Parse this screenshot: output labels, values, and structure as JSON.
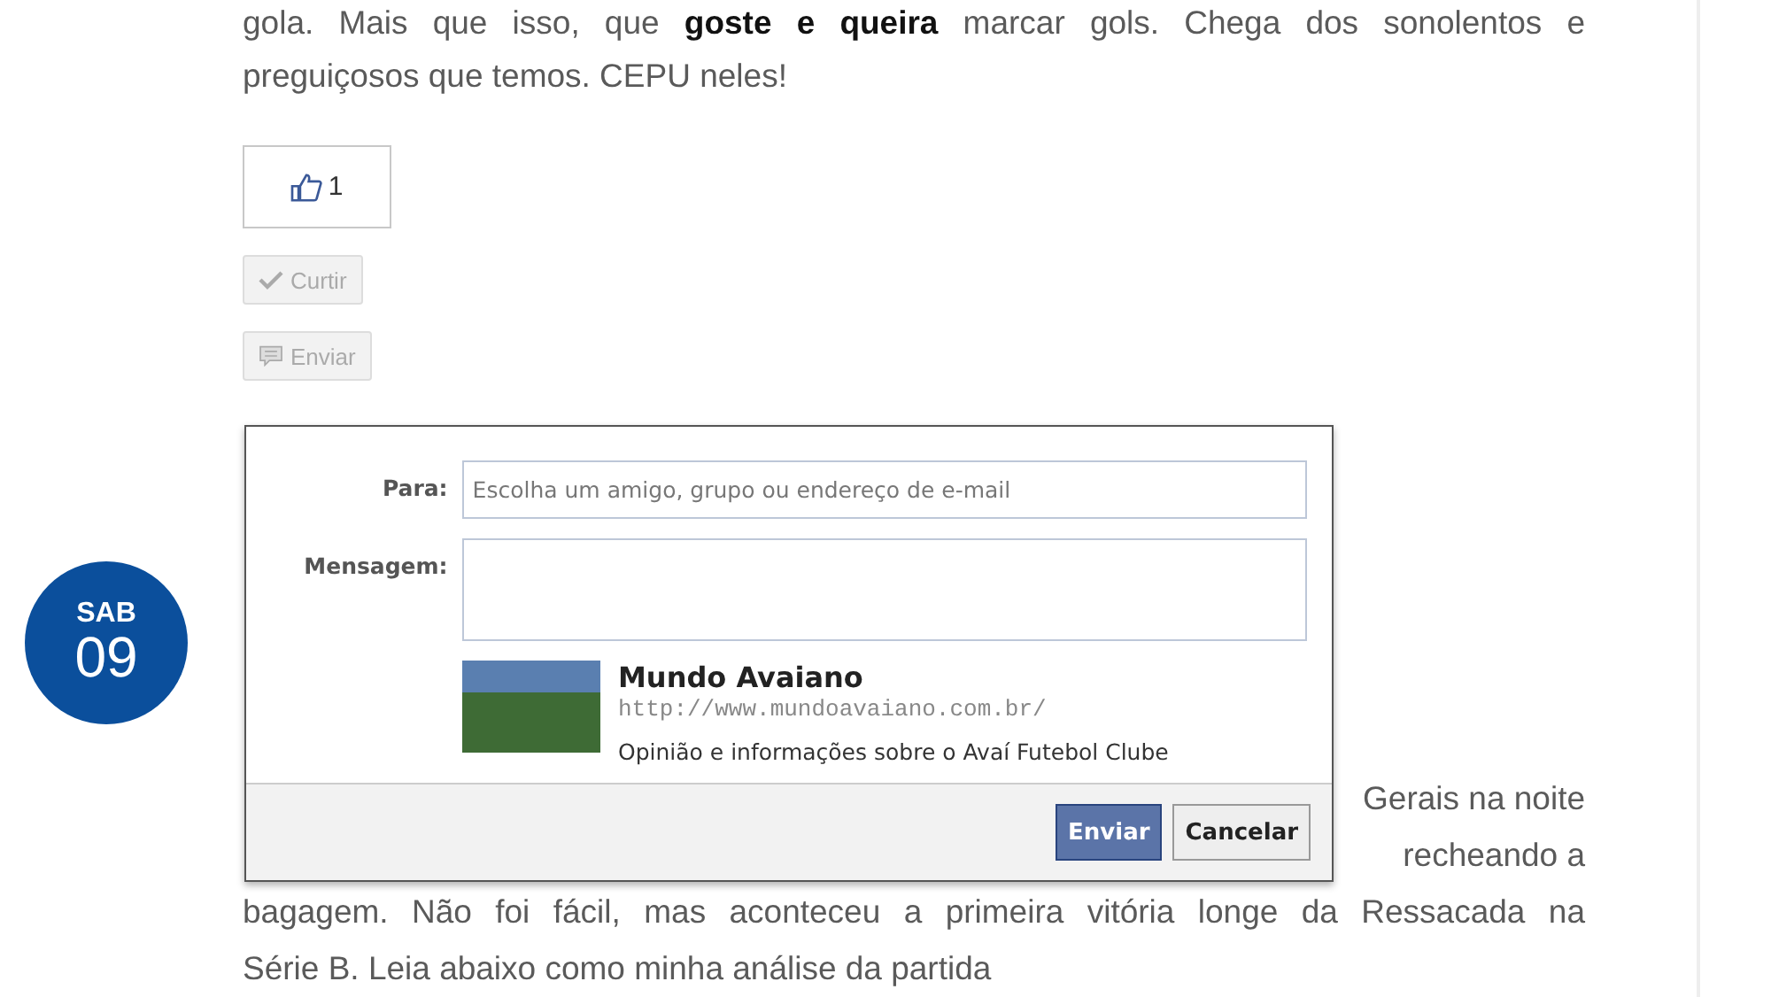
{
  "date_badge": {
    "weekday": "SAB",
    "day": "09"
  },
  "article_top": {
    "lines": [
      "gola. Mais que isso, que **goste e queira** marcar gols. Chega dos sonolentos e",
      "preguiçosos que temos. CEPU neles!"
    ]
  },
  "like_count": "1",
  "buttons": [
    {
      "label": "Curtir",
      "kind": "like"
    },
    {
      "label": "Enviar",
      "kind": "send"
    }
  ],
  "send_dialog": {
    "fields": [
      {
        "label": "Para:",
        "kind": "input",
        "placeholder": "Escolha um amigo, grupo ou endereço de e-mail"
      },
      {
        "label": "Mensagem:",
        "kind": "textarea"
      }
    ],
    "preview": {
      "title": "Mundo Avaiano",
      "url": "http://www.mundoavaiano.com.br/",
      "description": "Opinião e informações sobre o Avaí Futebol Clube"
    },
    "actions": [
      {
        "label": "Enviar",
        "primary": true
      },
      {
        "label": "Cancelar",
        "primary": false
      }
    ]
  },
  "article_next": {
    "lines": [
      "Gerais na noite",
      "recheando a",
      "bagagem. Não foi fácil, mas aconteceu a primeira vitória longe da Ressacada na",
      "Série B. Leia abaixo como minha análise da partida"
    ]
  }
}
